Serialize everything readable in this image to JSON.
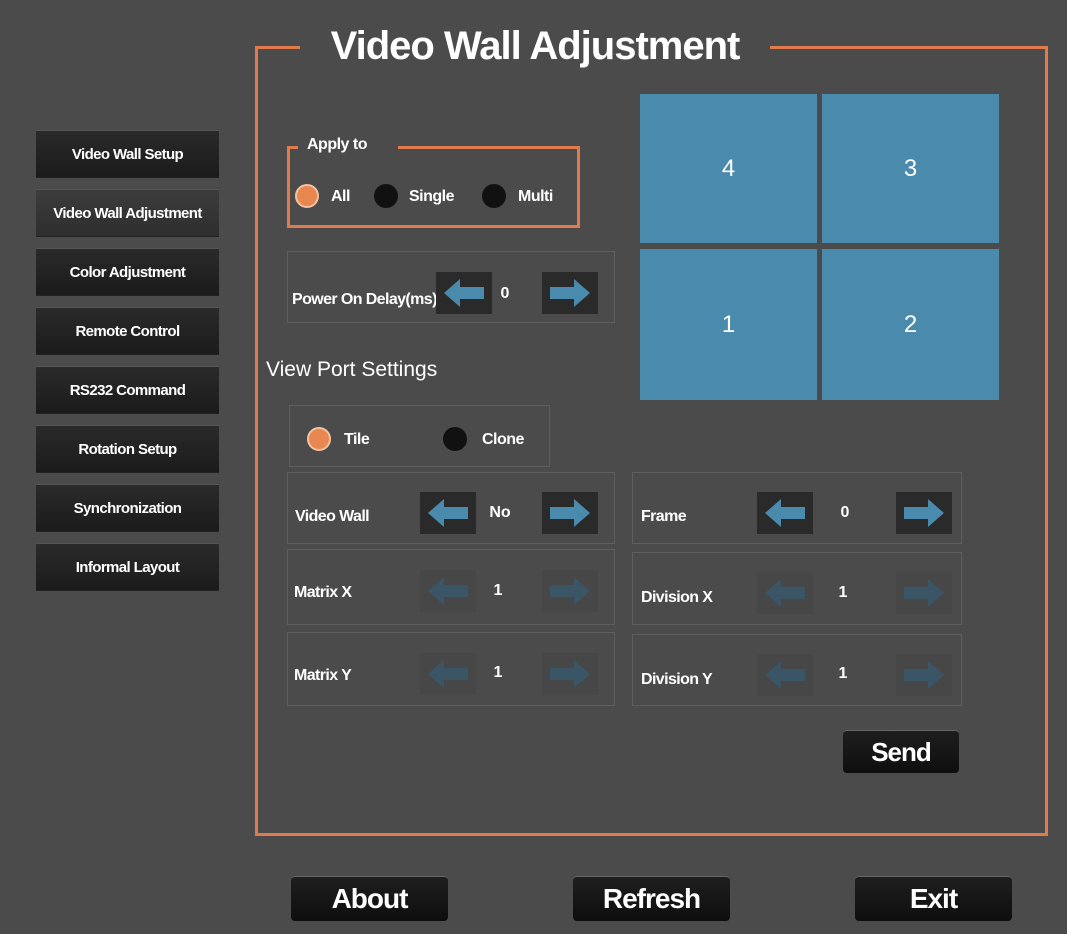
{
  "title": "Video Wall Adjustment",
  "sidebar": {
    "items": [
      {
        "label": "Video Wall Setup"
      },
      {
        "label": "Video Wall Adjustment"
      },
      {
        "label": "Color Adjustment"
      },
      {
        "label": "Remote Control"
      },
      {
        "label": "RS232 Command"
      },
      {
        "label": "Rotation Setup"
      },
      {
        "label": "Synchronization"
      },
      {
        "label": "Informal Layout"
      }
    ],
    "active_index": 1
  },
  "apply_to": {
    "label": "Apply to",
    "options": [
      "All",
      "Single",
      "Multi"
    ],
    "selected": "All"
  },
  "power_on_delay": {
    "label": "Power On Delay(ms)",
    "value": "0"
  },
  "grid": {
    "cells": [
      "4",
      "3",
      "1",
      "2"
    ]
  },
  "view_port": {
    "heading": "View Port Settings",
    "options": [
      "Tile",
      "Clone"
    ],
    "selected": "Tile"
  },
  "controls": {
    "video_wall": {
      "label": "Video Wall",
      "value": "No"
    },
    "matrix_x": {
      "label": "Matrix X",
      "value": "1"
    },
    "matrix_y": {
      "label": "Matrix Y",
      "value": "1"
    },
    "frame": {
      "label": "Frame",
      "value": "0"
    },
    "division_x": {
      "label": "Division X",
      "value": "1"
    },
    "division_y": {
      "label": "Division Y",
      "value": "1"
    }
  },
  "buttons": {
    "send": "Send",
    "about": "About",
    "refresh": "Refresh",
    "exit": "Exit"
  },
  "colors": {
    "accent": "#e07b4d",
    "tile": "#4a8aac",
    "arrow": "#4a8aac",
    "background": "#4b4b4b"
  }
}
